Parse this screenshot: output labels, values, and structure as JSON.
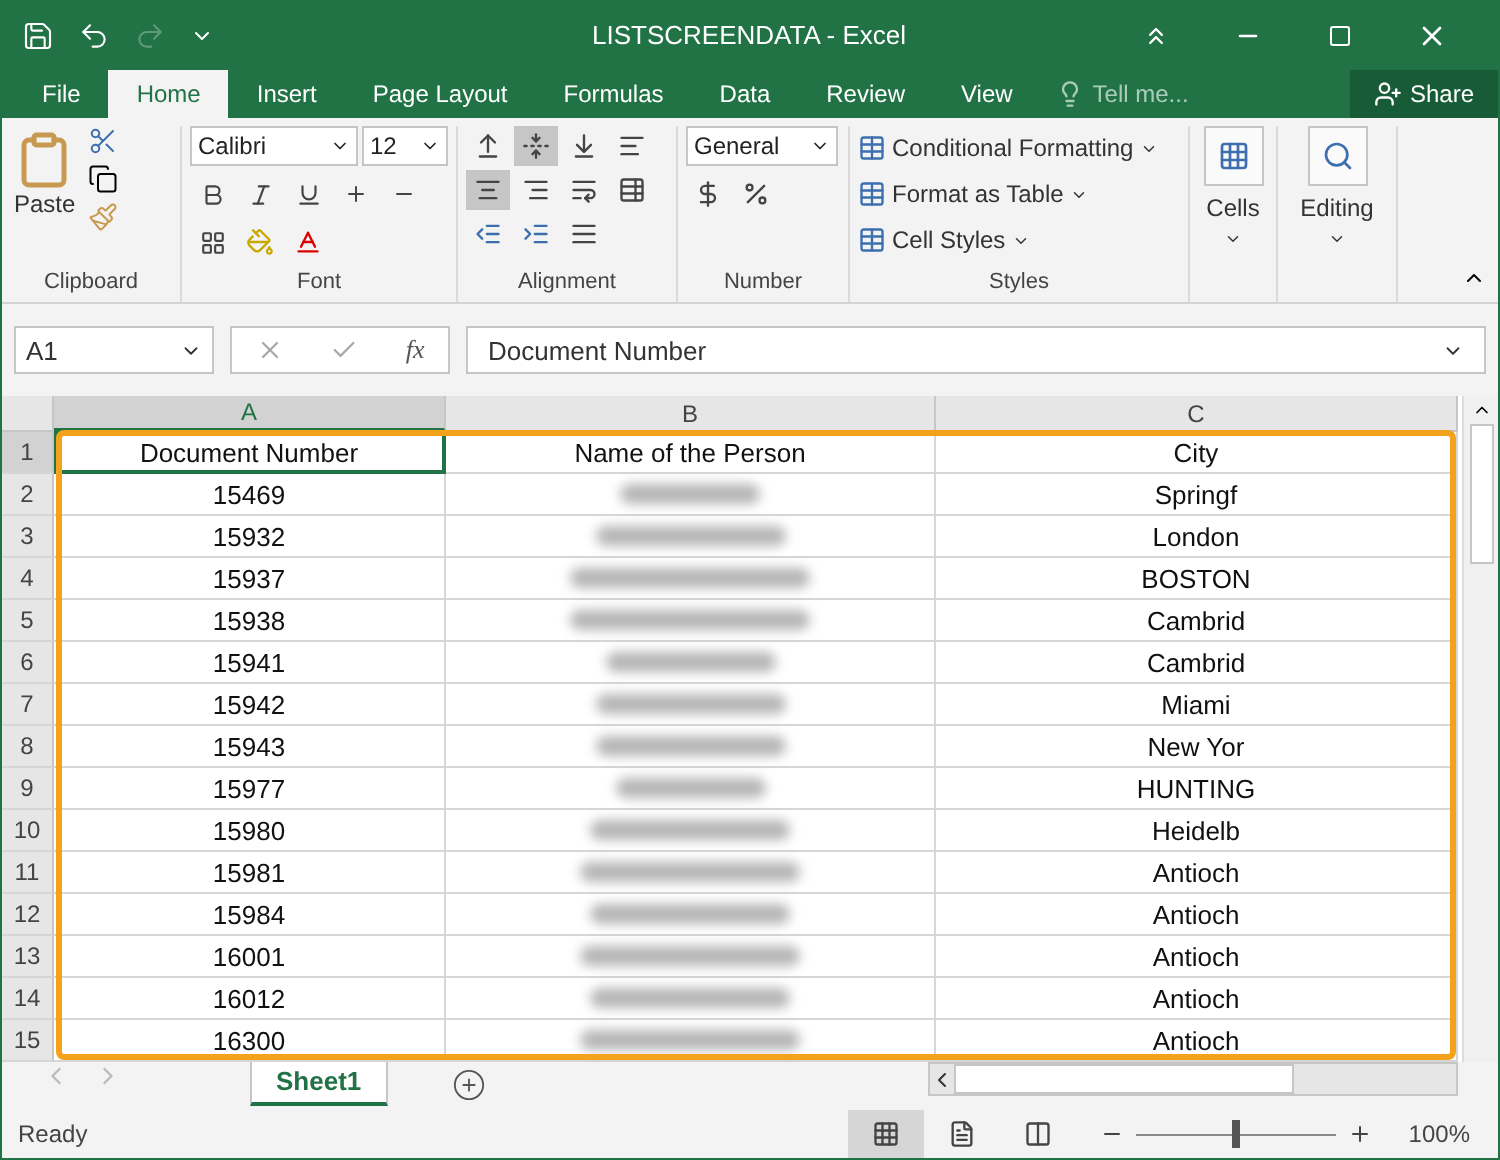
{
  "window": {
    "title": "LISTSCREENDATA - Excel"
  },
  "tabs": [
    {
      "label": "File",
      "selected": false
    },
    {
      "label": "Home",
      "selected": true
    },
    {
      "label": "Insert",
      "selected": false
    },
    {
      "label": "Page Layout",
      "selected": false
    },
    {
      "label": "Formulas",
      "selected": false
    },
    {
      "label": "Data",
      "selected": false
    },
    {
      "label": "Review",
      "selected": false
    },
    {
      "label": "View",
      "selected": false
    }
  ],
  "tell_me": {
    "placeholder": "Tell me..."
  },
  "share": "Share",
  "ribbon": {
    "paste": "Paste",
    "font_name": "Calibri",
    "font_size": "12",
    "number_format": "General",
    "alignment_buttons": [
      {
        "kind": "top",
        "selected": false
      },
      {
        "kind": "middle",
        "selected": true
      },
      {
        "kind": "bottom",
        "selected": false
      },
      {
        "kind": "left",
        "selected": false
      },
      {
        "kind": "center",
        "selected": true
      },
      {
        "kind": "right",
        "selected": false
      }
    ],
    "styles": [
      {
        "label": "Conditional Formatting"
      },
      {
        "label": "Format as Table"
      },
      {
        "label": "Cell Styles"
      }
    ],
    "cells": "Cells",
    "editing": "Editing",
    "groups": [
      "Clipboard",
      "Font",
      "Alignment",
      "Number",
      "Styles"
    ]
  },
  "formula_bar": {
    "name_box": "A1",
    "function_label": "fx",
    "value": "Document Number"
  },
  "columns": [
    {
      "label": "A",
      "selected": true
    },
    {
      "label": "B",
      "selected": false
    },
    {
      "label": "C",
      "selected": false
    }
  ],
  "rows": [
    {
      "number": "1",
      "doc": "Document Number",
      "name": "Name of the Person",
      "city": "City",
      "active": true
    },
    {
      "number": "2",
      "doc": "15469",
      "blurred": true,
      "city": "Springf",
      "active": false
    },
    {
      "number": "3",
      "doc": "15932",
      "blurred": true,
      "city": "London",
      "active": false
    },
    {
      "number": "4",
      "doc": "15937",
      "blurred": true,
      "city": "BOSTON",
      "active": false
    },
    {
      "number": "5",
      "doc": "15938",
      "blurred": true,
      "city": "Cambrid",
      "active": false
    },
    {
      "number": "6",
      "doc": "15941",
      "blurred": true,
      "city": "Cambrid",
      "active": false
    },
    {
      "number": "7",
      "doc": "15942",
      "blurred": true,
      "city": "Miami",
      "active": false
    },
    {
      "number": "8",
      "doc": "15943",
      "blurred": true,
      "city": "New Yor",
      "active": false
    },
    {
      "number": "9",
      "doc": "15977",
      "blurred": true,
      "city": "HUNTING",
      "active": false
    },
    {
      "number": "10",
      "doc": "15980",
      "blurred": true,
      "city": "Heidelb",
      "active": false
    },
    {
      "number": "11",
      "doc": "15981",
      "blurred": true,
      "city": "Antioch",
      "active": false
    },
    {
      "number": "12",
      "doc": "15984",
      "blurred": true,
      "city": "Antioch",
      "active": false
    },
    {
      "number": "13",
      "doc": "16001",
      "blurred": true,
      "city": "Antioch",
      "active": false
    },
    {
      "number": "14",
      "doc": "16012",
      "blurred": true,
      "city": "Antioch",
      "active": false
    },
    {
      "number": "15",
      "doc": "16300",
      "blurred": true,
      "city": "Antioch",
      "active": false
    }
  ],
  "sheet_tabs": [
    {
      "label": "Sheet1",
      "selected": true
    }
  ],
  "status_bar": {
    "text": "Ready",
    "views": [
      {
        "kind": "normal",
        "selected": true
      },
      {
        "kind": "page_layout",
        "selected": false
      },
      {
        "kind": "page_break",
        "selected": false
      }
    ],
    "zoom": {
      "level": 0.5,
      "reading": "100%"
    }
  }
}
